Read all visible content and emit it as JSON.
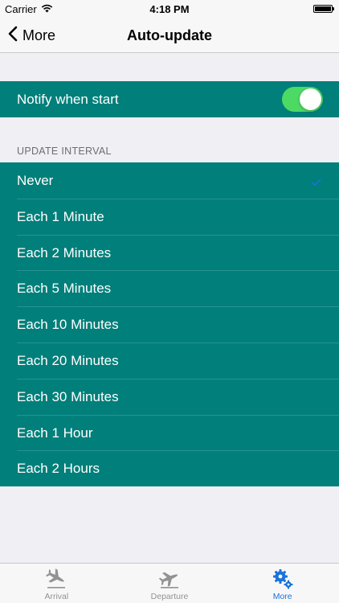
{
  "status_bar": {
    "carrier": "Carrier",
    "time": "4:18 PM"
  },
  "nav": {
    "back_label": "More",
    "title": "Auto-update"
  },
  "notify": {
    "label": "Notify when start",
    "enabled": true
  },
  "update_interval": {
    "header": "UPDATE INTERVAL",
    "selected": "Never",
    "options": [
      "Never",
      "Each 1 Minute",
      "Each 2 Minutes",
      "Each 5 Minutes",
      "Each 10 Minutes",
      "Each 20 Minutes",
      "Each 30 Minutes",
      "Each 1 Hour",
      "Each 2 Hours"
    ]
  },
  "tab_bar": {
    "tabs": [
      {
        "label": "Arrival",
        "icon": "plane-landing-icon"
      },
      {
        "label": "Departure",
        "icon": "plane-takeoff-icon"
      },
      {
        "label": "More",
        "icon": "gears-icon"
      }
    ],
    "active": "More"
  },
  "colors": {
    "row_background": "#017f7a",
    "switch_on": "#4cd964",
    "accent": "#1a73d9",
    "page_background": "#efeff4"
  }
}
